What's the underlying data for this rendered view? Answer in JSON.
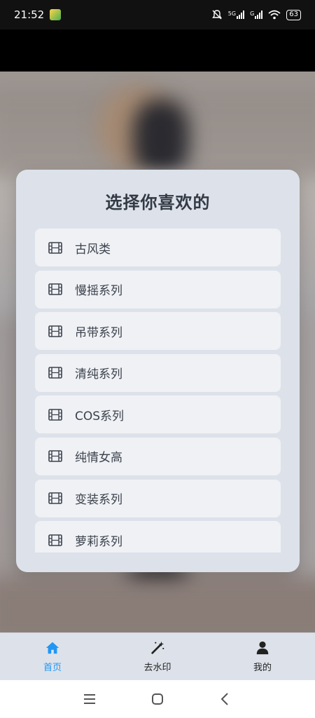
{
  "status_bar": {
    "time": "21:52",
    "network_1": "5G",
    "network_2": "G",
    "battery": "63"
  },
  "modal": {
    "title": "选择你喜欢的",
    "items": [
      {
        "label": "古风类",
        "icon": "film-icon"
      },
      {
        "label": "慢摇系列",
        "icon": "film-icon"
      },
      {
        "label": "吊带系列",
        "icon": "film-icon"
      },
      {
        "label": "清纯系列",
        "icon": "film-icon"
      },
      {
        "label": "COS系列",
        "icon": "film-icon"
      },
      {
        "label": "纯情女高",
        "icon": "film-icon"
      },
      {
        "label": "变装系列",
        "icon": "film-icon"
      },
      {
        "label": "萝莉系列",
        "icon": "film-icon"
      }
    ]
  },
  "tabbar": {
    "tabs": [
      {
        "label": "首页",
        "icon": "home-icon",
        "active": true
      },
      {
        "label": "去水印",
        "icon": "magic-wand-icon",
        "active": false
      },
      {
        "label": "我的",
        "icon": "user-icon",
        "active": false
      }
    ]
  },
  "colors": {
    "accent": "#2196f3",
    "card_bg": "#dde2ea",
    "item_bg": "#eff1f5",
    "text": "#3c424c"
  }
}
